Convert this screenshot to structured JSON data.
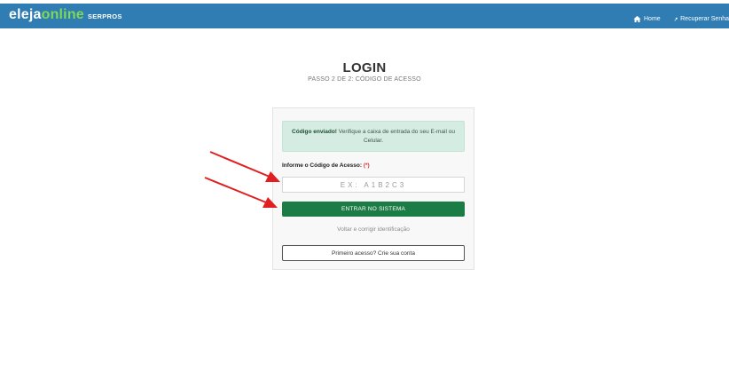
{
  "header": {
    "brand_part1": "eleja",
    "brand_part2": "online",
    "brand_suffix": "SERPROS",
    "nav_home": "Home",
    "nav_recover": "Recuperar Senha"
  },
  "page": {
    "title": "LOGIN",
    "subtitle": "PASSO 2 DE 2: CÓDIGO DE ACESSO"
  },
  "alert": {
    "strong": "Código enviado!",
    "text": " Verifique a caixa de entrada do seu E-mail ou Celular."
  },
  "form": {
    "label": "Informe o Código de Acesso: ",
    "required_mark": "(*)",
    "code_placeholder": "EX: A1B2C3",
    "code_value": "",
    "submit_label": "ENTRAR NO SISTEMA",
    "back_link": "Voltar e corrigir identificação",
    "first_access_label": "Primeiro acesso? Crie sua conta"
  },
  "colors": {
    "topbar": "#2f7db2",
    "brand_accent": "#7ed957",
    "submit": "#1c7c45",
    "alert_bg": "#d4ece1",
    "annotation_arrow": "#e02020"
  },
  "icons": {
    "home": "home-icon",
    "recover": "key-icon"
  }
}
